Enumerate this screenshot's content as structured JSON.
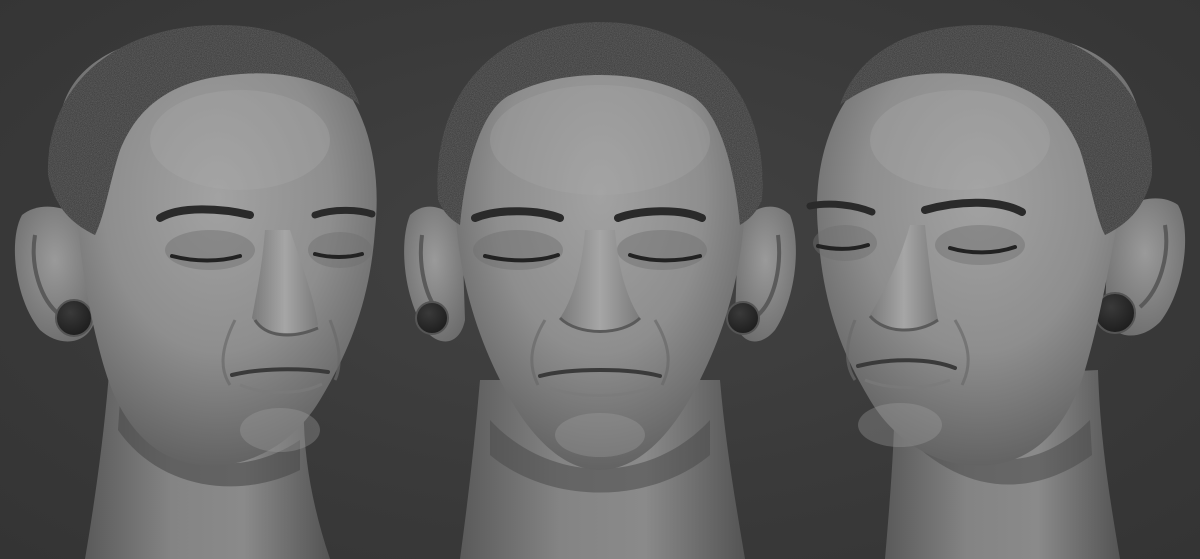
{
  "scene": {
    "background_color": "#3a3a3a",
    "clay_color": "#8c8c8c",
    "hair_color": "#2c2c2c",
    "plug_color": "#262626",
    "views": [
      {
        "id": "three-quarter-left",
        "turn": "left"
      },
      {
        "id": "front",
        "turn": "none"
      },
      {
        "id": "three-quarter-right",
        "turn": "right"
      }
    ]
  }
}
